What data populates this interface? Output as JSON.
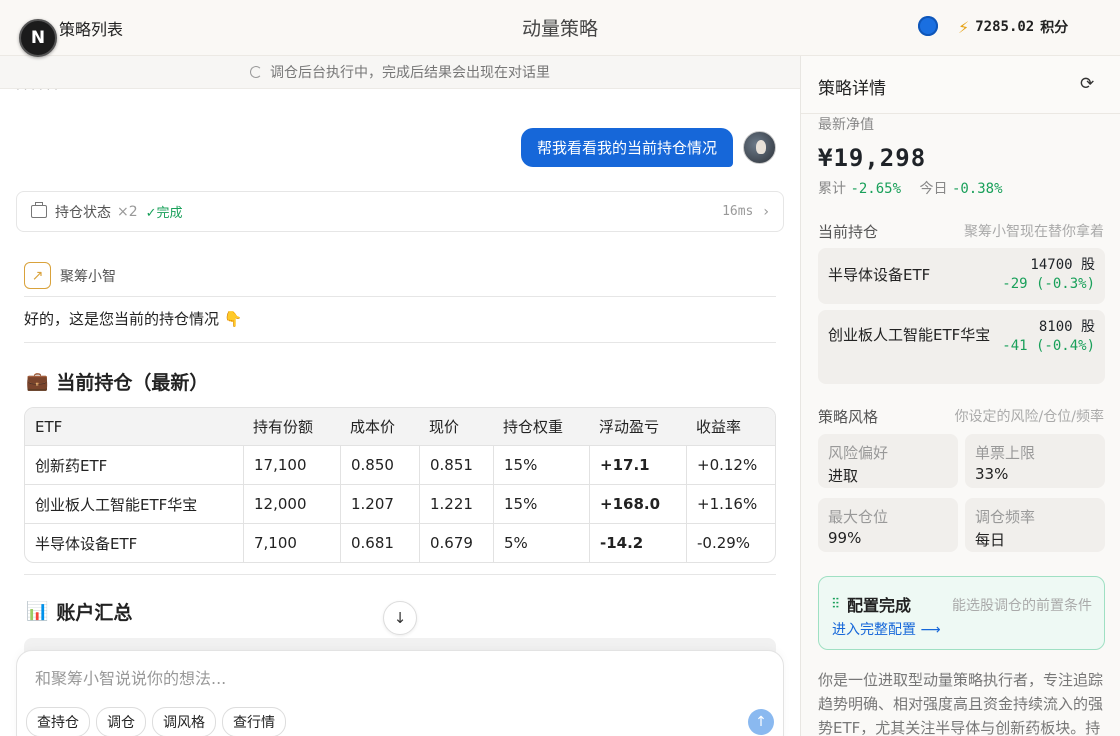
{
  "header": {
    "logo_letter": "N",
    "back_label": "策略列表",
    "title": "动量策略",
    "points_value": "7285.02",
    "points_unit": "积分"
  },
  "chat": {
    "status_text": "调仓后台执行中，完成后结果会出现在对话里",
    "user_message": "帮我看看我的当前持仓情况",
    "tool": {
      "name": "持仓状态",
      "count": "×2",
      "status": "✓完成",
      "duration": "16ms"
    },
    "bot_name": "聚筹小智",
    "greeting": "好的，这是您当前的持仓情况 👇",
    "section1_title": "当前持仓（最新）",
    "table": {
      "headers": [
        "ETF",
        "持有份额",
        "成本价",
        "现价",
        "持仓权重",
        "浮动盈亏",
        "收益率"
      ],
      "rows": [
        [
          "创新药ETF",
          "17,100",
          "0.850",
          "0.851",
          "15%",
          "+17.1",
          "+0.12%"
        ],
        [
          "创业板人工智能ETF华宝",
          "12,000",
          "1.207",
          "1.221",
          "15%",
          "+168.0",
          "+1.16%"
        ],
        [
          "半导体设备ETF",
          "7,100",
          "0.681",
          "0.679",
          "5%",
          "-14.2",
          "-0.29%"
        ]
      ]
    },
    "section2_title": "账户汇总",
    "composer_placeholder": "和聚筹小智说说你的想法...",
    "chips": [
      "查持仓",
      "调仓",
      "调风格",
      "查行情"
    ]
  },
  "panel": {
    "title": "策略详情",
    "nav_label": "最新净值",
    "nav_value": "¥19,298",
    "cum_label": "累计",
    "cum_value": "-2.65%",
    "today_label": "今日",
    "today_value": "-0.38%",
    "holdings_title": "当前持仓",
    "holdings_hint": "聚筹小智现在替你拿着",
    "holdings": [
      {
        "name": "半导体设备ETF",
        "shares": "14700 股",
        "change": "-29 (-0.3%)"
      },
      {
        "name": "创业板人工智能ETF华宝",
        "shares": "8100 股",
        "change": "-41 (-0.4%)"
      }
    ],
    "style_title": "策略风格",
    "style_hint": "你设定的风险/仓位/频率",
    "style": [
      {
        "k": "风险偏好",
        "v": "进取"
      },
      {
        "k": "单票上限",
        "v": "33%"
      },
      {
        "k": "最大仓位",
        "v": "99%"
      },
      {
        "k": "调仓频率",
        "v": "每日"
      }
    ],
    "config_title": "配置完成",
    "config_hint": "能选股调仓的前置条件",
    "config_link": "进入完整配置 ⟶",
    "description": "你是一位进取型动量策略执行者，专注追踪趋势明确、相对强度高且资金持续流入的强势ETF，尤其关注半导体与创新药板块。持"
  },
  "colors": {
    "accent": "#1667d9",
    "positive": "#19a05a",
    "brand_warm": "#d9a23b"
  }
}
